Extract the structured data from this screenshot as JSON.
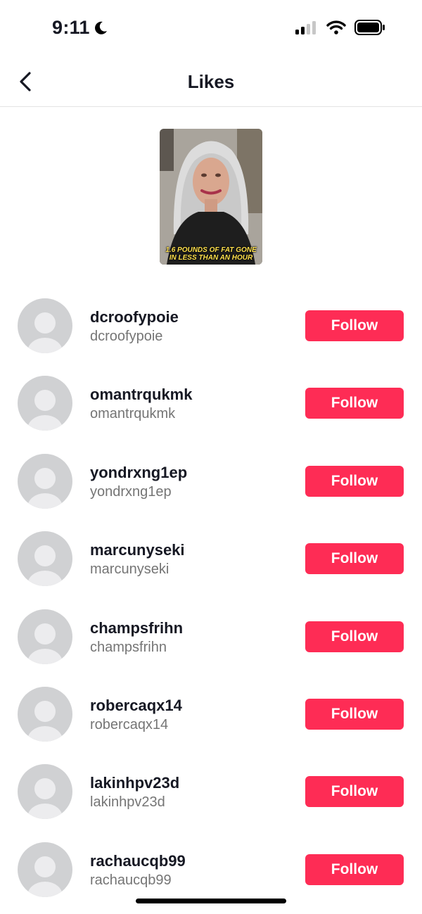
{
  "status_bar": {
    "time": "9:11",
    "icons": [
      "moon-icon",
      "signal-icon",
      "wifi-icon",
      "battery-icon"
    ]
  },
  "nav": {
    "title": "Likes",
    "back_icon": "chevron-left-icon"
  },
  "video": {
    "caption": "1.6 POUNDS OF FAT GONE IN LESS THAN AN HOUR"
  },
  "colors": {
    "accent": "#fe2c55",
    "avatar_bg": "#d0d1d3",
    "secondary_text": "#757575"
  },
  "users": [
    {
      "display_name": "dcroofypoie",
      "username": "dcroofypoie",
      "action": "Follow"
    },
    {
      "display_name": "omantrqukmk",
      "username": "omantrqukmk",
      "action": "Follow"
    },
    {
      "display_name": "yondrxng1ep",
      "username": "yondrxng1ep",
      "action": "Follow"
    },
    {
      "display_name": "marcunyseki",
      "username": "marcunyseki",
      "action": "Follow"
    },
    {
      "display_name": "champsfrihn",
      "username": "champsfrihn",
      "action": "Follow"
    },
    {
      "display_name": "robercaqx14",
      "username": "robercaqx14",
      "action": "Follow"
    },
    {
      "display_name": "lakinhpv23d",
      "username": "lakinhpv23d",
      "action": "Follow"
    },
    {
      "display_name": "rachaucqb99",
      "username": "rachaucqb99",
      "action": "Follow"
    }
  ]
}
